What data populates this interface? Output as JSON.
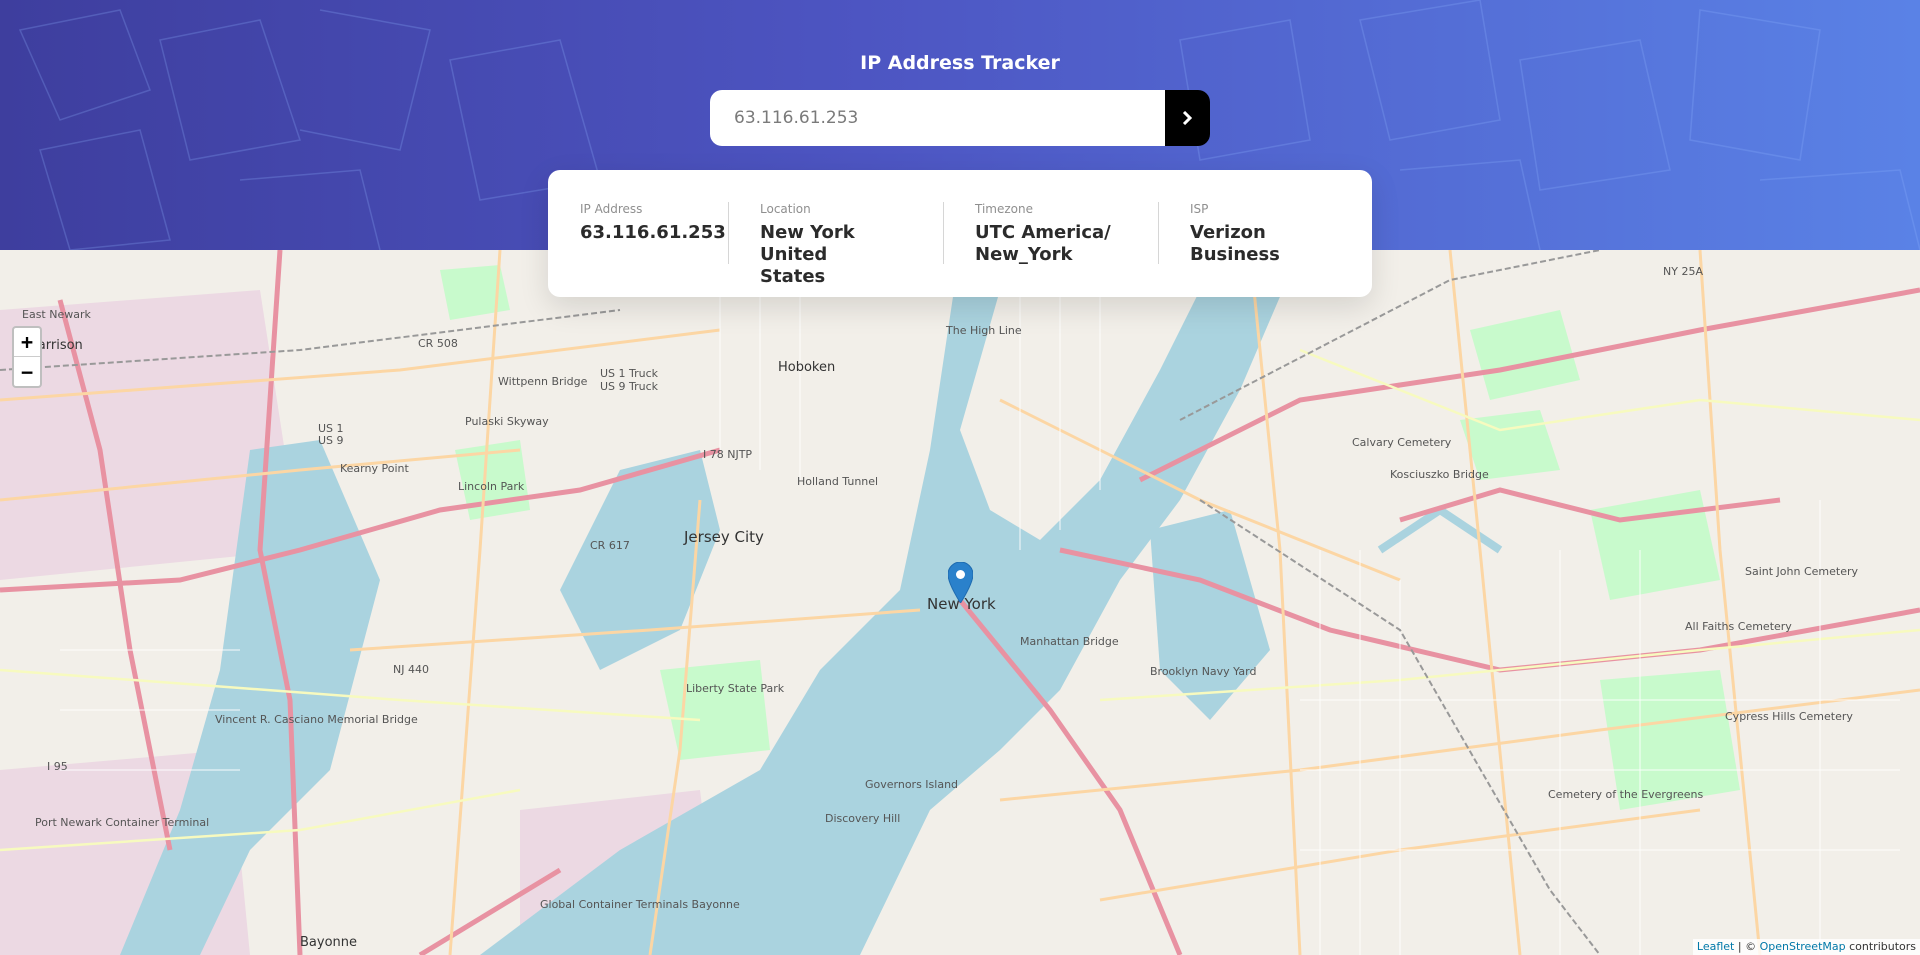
{
  "app": {
    "title": "IP Address Tracker"
  },
  "search": {
    "value": "",
    "placeholder": "63.116.61.253"
  },
  "info": {
    "ip_label": "IP Address",
    "ip_value": "63.116.61.253",
    "location_label": "Location",
    "location_value_line1": "New York United",
    "location_value_line2": "States",
    "timezone_label": "Timezone",
    "timezone_value_line1": "UTC America/",
    "timezone_value_line2": "New_York",
    "isp_label": "ISP",
    "isp_value": "Verizon Business"
  },
  "map": {
    "zoom_in": "+",
    "zoom_out": "−",
    "attribution_leaflet": "Leaflet",
    "attribution_sep": " | © ",
    "attribution_osm": "OpenStreetMap",
    "attribution_tail": " contributors",
    "labels": {
      "new_york": "New York",
      "jersey_city": "Jersey City",
      "hoboken": "Hoboken",
      "harrison": "Harrison",
      "east_newark": "East Newark",
      "kearny_point": "Kearny Point",
      "pulaski_skyway": "Pulaski Skyway",
      "manhattan_bridge": "Manhattan Bridge",
      "kosciuszko_bridge": "Kosciuszko Bridge",
      "calvary_cemetery": "Calvary Cemetery",
      "liberty_state_park": "Liberty State Park",
      "governors_island": "Governors Island",
      "vincent_bridge": "Vincent R. Casciano Memorial Bridge",
      "bayonne": "Bayonne",
      "port_newark": "Port Newark Container Terminal",
      "the_high_line": "The High Line",
      "saint_john_cemetery": "Saint John Cemetery",
      "cypress_hills_cemetery": "Cypress Hills Cemetery",
      "all_faiths_cemetery": "All Faiths Cemetery",
      "cemetery_evergreens": "Cemetery of the Evergreens",
      "brooklyn_navy_yard": "Brooklyn Navy Yard",
      "lincoln_park": "Lincoln Park",
      "wittpenn_bridge": "Wittpenn Bridge",
      "discovery_hill": "Discovery Hill",
      "global_terminals": "Global Container Terminals Bayonne",
      "us1_truck": "US 1 Truck",
      "us9_truck": "US 9 Truck",
      "i78_njtp": "I 78 NJTP",
      "us1": "US 1",
      "us9": "US 9",
      "cr508": "CR 508",
      "cr617": "CR 617",
      "nj440": "NJ 440",
      "i95": "I 95",
      "ny25a": "NY 25A",
      "holland_tunnel": "Holland Tunnel"
    }
  },
  "colors": {
    "header_start": "#3e3e9e",
    "header_end": "#5a82e6",
    "water": "#aad3df",
    "land": "#f2efe9",
    "marker": "#2a81cb",
    "highway": "#e892a2",
    "primary_road": "#fcd6a4",
    "park": "#c8facc"
  }
}
